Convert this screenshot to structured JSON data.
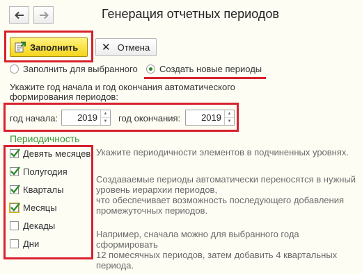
{
  "nav": {
    "back_icon": "arrow-left-icon",
    "forward_icon": "arrow-right-icon"
  },
  "window": {
    "title": "Генерация отчетных периодов"
  },
  "toolbar": {
    "fill_label": "Заполнить",
    "cancel_label": "Отмена"
  },
  "mode": {
    "option_selected_only": "Заполнить для выбранного",
    "option_create_new": "Создать новые периоды",
    "selected": "option_create_new"
  },
  "instruction": "Укажите год начала и год окончания автоматического формирования периодов:",
  "years": {
    "start_label": "год начала:",
    "start_value": "2019",
    "end_label": "год окончания:",
    "end_value": "2019"
  },
  "periodicity": {
    "header": "Периодичность",
    "items": [
      {
        "label": "Девять месяцев",
        "checked": true
      },
      {
        "label": "Полугодия",
        "checked": true
      },
      {
        "label": "Кварталы",
        "checked": true
      },
      {
        "label": "Месяцы",
        "checked": true
      },
      {
        "label": "Декады",
        "checked": false
      },
      {
        "label": "Дни",
        "checked": false
      }
    ]
  },
  "hints": {
    "line1": "Укажите периодичности элементов в подчиненных уровнях.",
    "p2_line1": "Создаваемые периоды автоматически переносятся в нужный",
    "p2_line2": "уровень иерархии периодов,",
    "p2_line3": "что обеспечивает возможность последующего добавления",
    "p2_line4": "промежуточных периодов.",
    "p3_line1": "Например, сначала можно для выбранного года",
    "p3_line2": "сформировать",
    "p3_line3": "12 помесячных периодов, затем добавить 4 квартальных",
    "p3_line4": "периода."
  },
  "colors": {
    "highlight": "#d8212c",
    "accent_green": "#3a9a3a",
    "fill_button": "#f5d51c"
  }
}
